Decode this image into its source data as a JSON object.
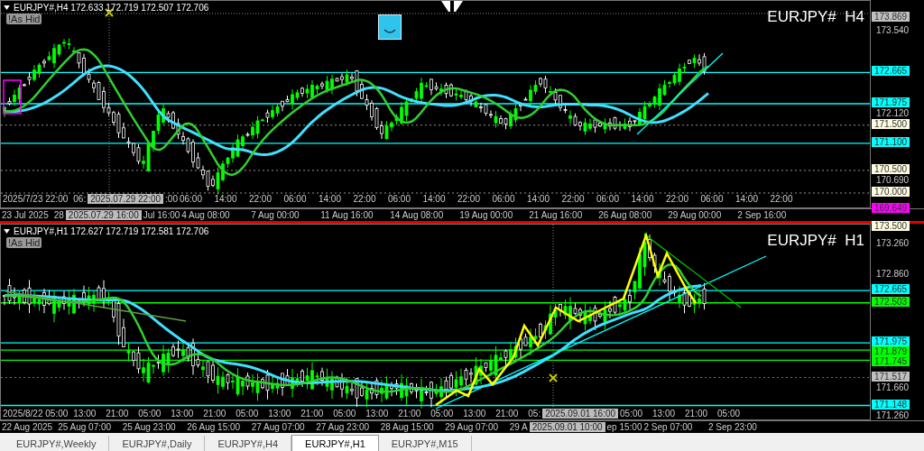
{
  "panes": [
    {
      "info": "EURJPY#,H4  172.633 172.719 172.507 172.706",
      "badge": "!As Hid",
      "title": "EURJPY#  H4",
      "price_ticks": [
        "173.540",
        "172.120",
        "170.690"
      ],
      "levels": [
        {
          "price": "173.869",
          "color": "#c0c0c0",
          "kind": "none"
        },
        {
          "price": "172.665",
          "color": "#00ffff",
          "kind": "solid"
        },
        {
          "price": "171.975",
          "color": "#00ffff",
          "kind": "solid"
        },
        {
          "price": "171.500",
          "color": "#fffbe0",
          "kind": "dotted"
        },
        {
          "price": "171.100",
          "color": "#00ffff",
          "kind": "solid"
        },
        {
          "price": "170.500",
          "color": "#fffbe0",
          "kind": "dotted"
        },
        {
          "price": "170.000",
          "color": "#fffbe0",
          "kind": "dotted"
        },
        {
          "price": "169.649",
          "color": "#ff00ff",
          "kind": "solid"
        }
      ],
      "upper_times": [
        {
          "text": "2025/7/23 22:00",
          "kind": "wide"
        },
        {
          "text": "06:",
          "kind": "cut"
        },
        {
          "text": "2025.07.29 22:00",
          "kind": "cursor"
        },
        {
          "text": ":00",
          "kind": "cut"
        },
        {
          "text": "06:00",
          "kind": "tick"
        },
        {
          "text": "14:00",
          "kind": "tick"
        },
        {
          "text": "22:00",
          "kind": "tick"
        },
        {
          "text": "06:00",
          "kind": "tick"
        },
        {
          "text": "14:00",
          "kind": "tick"
        },
        {
          "text": "22:00",
          "kind": "tick"
        },
        {
          "text": "06:00",
          "kind": "tick"
        },
        {
          "text": "14:00",
          "kind": "tick"
        },
        {
          "text": "22:00",
          "kind": "tick"
        },
        {
          "text": "06:00",
          "kind": "tick"
        },
        {
          "text": "14:00",
          "kind": "tick"
        },
        {
          "text": "22:00",
          "kind": "tick"
        },
        {
          "text": "06:00",
          "kind": "tick"
        },
        {
          "text": "14:00",
          "kind": "tick"
        },
        {
          "text": "22:00",
          "kind": "tick"
        },
        {
          "text": "06:00",
          "kind": "tick"
        },
        {
          "text": "14:00",
          "kind": "tick"
        },
        {
          "text": "22:00",
          "kind": "tick"
        }
      ],
      "lower_times": [
        {
          "text": "23 Jul 2025",
          "kind": "wide"
        },
        {
          "text": "28",
          "kind": "cut"
        },
        {
          "text": "2025.07.29 16:00",
          "kind": "cursor"
        },
        {
          "text": "Jul 16:00",
          "kind": "cut"
        },
        {
          "text": "4 Aug 08:00",
          "kind": "tick"
        },
        {
          "text": "7 Aug 00:00",
          "kind": "tick"
        },
        {
          "text": "11 Aug 16:00",
          "kind": "tick"
        },
        {
          "text": "14 Aug 08:00",
          "kind": "tick"
        },
        {
          "text": "19 Aug 00:00",
          "kind": "tick"
        },
        {
          "text": "21 Aug 16:00",
          "kind": "tick"
        },
        {
          "text": "26 Aug 08:00",
          "kind": "tick"
        },
        {
          "text": "29 Aug 00:00",
          "kind": "tick"
        },
        {
          "text": "2 Sep 16:00",
          "kind": "tick"
        }
      ]
    },
    {
      "info": "EURJPY#,H1  172.627 172.719 172.581 172.706",
      "badge": "!As Hid",
      "title": "EURJPY#  H1",
      "price_ticks": [
        "173.260",
        "172.860",
        "171.660",
        "171.260"
      ],
      "levels": [
        {
          "price": "173.500",
          "color": "#fffbe0",
          "kind": "none"
        },
        {
          "price": "172.665",
          "color": "#00ffff",
          "kind": "solid"
        },
        {
          "price": "172.503",
          "color": "#00ff00",
          "kind": "solid"
        },
        {
          "price": "171.975",
          "color": "#00ffff",
          "kind": "solid"
        },
        {
          "price": "171.879",
          "color": "#00ff00",
          "kind": "solid"
        },
        {
          "price": "171.745",
          "color": "#00ff00",
          "kind": "solid"
        },
        {
          "price": "171.517",
          "color": "#c0c0c0",
          "kind": "dotted"
        },
        {
          "price": "171.148",
          "color": "#00ffff",
          "kind": "solid"
        }
      ],
      "upper_times": [
        {
          "text": "2025/8/22 05:00",
          "kind": "wide"
        },
        {
          "text": "13:00",
          "kind": "tick"
        },
        {
          "text": "21:00",
          "kind": "tick"
        },
        {
          "text": "05:00",
          "kind": "tick"
        },
        {
          "text": "13:00",
          "kind": "tick"
        },
        {
          "text": "21:00",
          "kind": "tick"
        },
        {
          "text": "05:00",
          "kind": "tick"
        },
        {
          "text": "13:00",
          "kind": "tick"
        },
        {
          "text": "21:00",
          "kind": "tick"
        },
        {
          "text": "05:00",
          "kind": "tick"
        },
        {
          "text": "13:00",
          "kind": "tick"
        },
        {
          "text": "21:00",
          "kind": "tick"
        },
        {
          "text": "05:00",
          "kind": "tick"
        },
        {
          "text": "13:00",
          "kind": "tick"
        },
        {
          "text": "21:00",
          "kind": "tick"
        },
        {
          "text": "05:",
          "kind": "cut"
        },
        {
          "text": "2025.09.01 16:00",
          "kind": "cursor"
        },
        {
          "text": "05:00",
          "kind": "tick"
        },
        {
          "text": "13:00",
          "kind": "tick"
        },
        {
          "text": "21:00",
          "kind": "tick"
        },
        {
          "text": "05:00",
          "kind": "tick"
        }
      ],
      "lower_times": [
        {
          "text": "22 Aug 2025",
          "kind": "wide"
        },
        {
          "text": "25 Aug 07:00",
          "kind": "tick"
        },
        {
          "text": "25 Aug 23:00",
          "kind": "tick"
        },
        {
          "text": "26 Aug 15:00",
          "kind": "tick"
        },
        {
          "text": "27 Aug 07:00",
          "kind": "tick"
        },
        {
          "text": "27 Aug 23:00",
          "kind": "tick"
        },
        {
          "text": "28 Aug 15:00",
          "kind": "tick"
        },
        {
          "text": "29 Aug 07:00",
          "kind": "tick"
        },
        {
          "text": "29 A",
          "kind": "cut"
        },
        {
          "text": "2025.09.01 10:00",
          "kind": "cursor"
        },
        {
          "text": "ep 15:00",
          "kind": "cut"
        },
        {
          "text": "2 Sep 07:00",
          "kind": "tick"
        },
        {
          "text": "2 Sep 23:00",
          "kind": "tick"
        }
      ]
    }
  ],
  "tabs": [
    {
      "label": "EURJPY#,Weekly",
      "selected": false
    },
    {
      "label": "EURJPY#,Daily",
      "selected": false
    },
    {
      "label": "EURJPY#,H4",
      "selected": false
    },
    {
      "label": "EURJPY#,H1",
      "selected": true
    },
    {
      "label": "EURJPY#,M15",
      "selected": false
    }
  ]
}
